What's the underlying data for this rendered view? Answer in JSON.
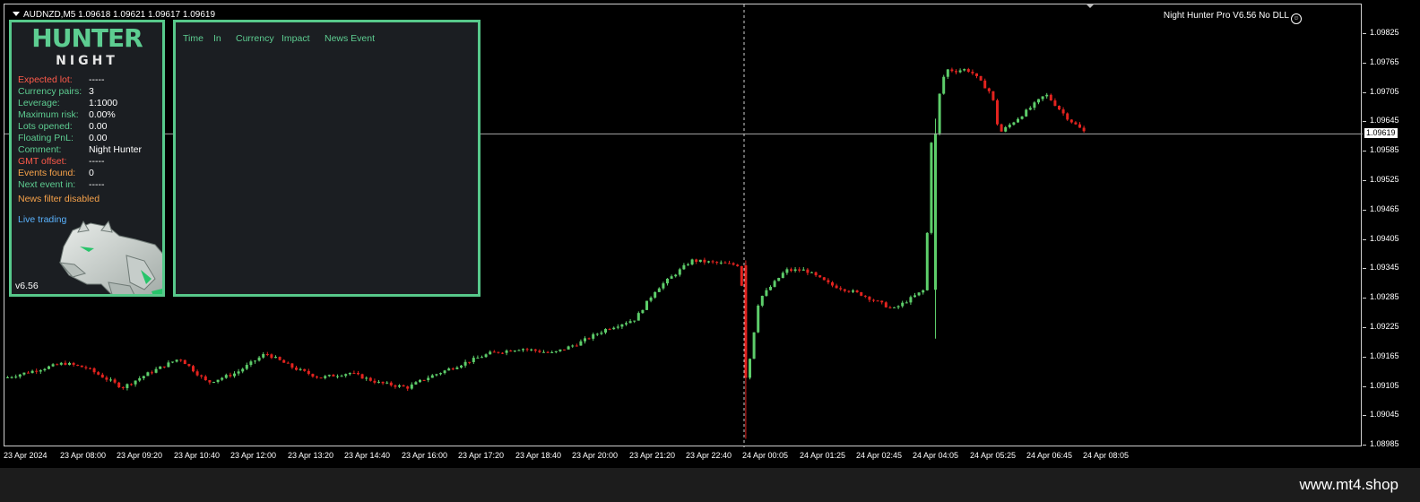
{
  "chart": {
    "symbol_label": "AUDNZD,M5  1.09618 1.09621 1.09617 1.09619",
    "ea_label": "Night Hunter Pro V6.56 No DLL",
    "ea_smiley_icon": "smiley-icon",
    "current_price": "1.09619",
    "price_ticks": [
      "1.09825",
      "1.09765",
      "1.09705",
      "1.09645",
      "1.09585",
      "1.09525",
      "1.09465",
      "1.09405",
      "1.09345",
      "1.09285",
      "1.09225",
      "1.09165",
      "1.09105",
      "1.09045",
      "1.08985"
    ],
    "time_ticks": [
      "23 Apr 2024",
      "23 Apr 08:00",
      "23 Apr 09:20",
      "23 Apr 10:40",
      "23 Apr 12:00",
      "23 Apr 13:20",
      "23 Apr 14:40",
      "23 Apr 16:00",
      "23 Apr 17:20",
      "23 Apr 18:40",
      "23 Apr 20:00",
      "23 Apr 21:20",
      "23 Apr 22:40",
      "24 Apr 00:05",
      "24 Apr 01:25",
      "24 Apr 02:45",
      "24 Apr 04:05",
      "24 Apr 05:25",
      "24 Apr 06:45",
      "24 Apr 08:05"
    ],
    "bull_color": "#5dcd6a",
    "bear_color": "#e3231f"
  },
  "chart_data": {
    "type": "candlestick",
    "symbol": "AUDNZD",
    "timeframe": "M5",
    "ylim": [
      1.08985,
      1.09855
    ],
    "last_price": 1.09619,
    "x": [
      "23 Apr 06:30",
      "23 Apr 07:20",
      "23 Apr 08:00",
      "23 Apr 09:20",
      "23 Apr 09:40",
      "23 Apr 10:40",
      "23 Apr 11:10",
      "23 Apr 12:00",
      "23 Apr 12:40",
      "23 Apr 13:20",
      "23 Apr 14:00",
      "23 Apr 14:40",
      "23 Apr 15:20",
      "23 Apr 16:00",
      "23 Apr 16:30",
      "23 Apr 17:20",
      "23 Apr 18:00",
      "23 Apr 18:40",
      "23 Apr 19:20",
      "23 Apr 20:00",
      "23 Apr 20:40",
      "23 Apr 21:20",
      "23 Apr 21:50",
      "23 Apr 22:40",
      "23 Apr 23:55",
      "24 Apr 00:05",
      "24 Apr 00:20",
      "24 Apr 00:50",
      "24 Apr 01:25",
      "24 Apr 02:00",
      "24 Apr 02:45",
      "24 Apr 03:20",
      "24 Apr 03:55",
      "24 Apr 04:05",
      "24 Apr 04:20",
      "24 Apr 04:45",
      "24 Apr 05:10",
      "24 Apr 05:25",
      "24 Apr 06:00",
      "24 Apr 06:25",
      "24 Apr 06:45",
      "24 Apr 07:05"
    ],
    "close": [
      1.0912,
      1.0915,
      1.0914,
      1.091,
      1.0913,
      1.0916,
      1.0911,
      1.0913,
      1.0917,
      1.0914,
      1.0912,
      1.0913,
      1.0911,
      1.091,
      1.0912,
      1.0915,
      1.0917,
      1.0918,
      1.0917,
      1.0919,
      1.0922,
      1.0924,
      1.093,
      1.0936,
      1.0935,
      1.091,
      1.0928,
      1.0934,
      1.0934,
      1.0931,
      1.0929,
      1.0926,
      1.093,
      1.0963,
      1.0975,
      1.0975,
      1.097,
      1.0962,
      1.0966,
      1.097,
      1.0965,
      1.0962
    ],
    "notes": ""
  },
  "hunter": {
    "logo_top": "HUNTER",
    "logo_bottom": "NIGHT",
    "rows": [
      {
        "key": "Expected lot:",
        "value": "-----",
        "color": "red"
      },
      {
        "key": "Currency pairs:",
        "value": "3",
        "color": "green"
      },
      {
        "key": "Leverage:",
        "value": "1:1000",
        "color": "green"
      },
      {
        "key": "Maximum risk:",
        "value": "0.00%",
        "color": "green"
      },
      {
        "key": "Lots opened:",
        "value": "0.00",
        "color": "green"
      },
      {
        "key": "Floating PnL:",
        "value": "0.00",
        "color": "green"
      },
      {
        "key": "Comment:",
        "value": "Night Hunter",
        "color": "green"
      },
      {
        "key": "GMT offset:",
        "value": "-----",
        "color": "red"
      },
      {
        "key": "Events found:",
        "value": "0",
        "color": "orange"
      },
      {
        "key": "Next event in:",
        "value": "-----",
        "color": "green"
      }
    ],
    "status_news": "News filter disabled",
    "status_trading": "Live trading",
    "version": "v6.56"
  },
  "news": {
    "headers": [
      "Time",
      "In",
      "Currency",
      "Impact",
      "News Event"
    ]
  },
  "watermark": "www.mt4.shop"
}
